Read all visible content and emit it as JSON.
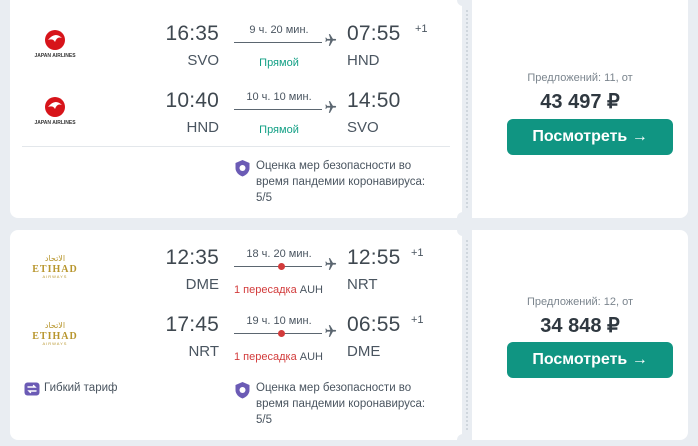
{
  "results": [
    {
      "legs": [
        {
          "airline": "JAPAN AIRLINES",
          "dep_time": "16:35",
          "dep_code": "SVO",
          "duration": "9 ч. 20 мин.",
          "arr_time": "07:55",
          "arr_plus": "+1",
          "arr_code": "HND",
          "route_note": "Прямой"
        },
        {
          "airline": "JAPAN AIRLINES",
          "dep_time": "10:40",
          "dep_code": "HND",
          "duration": "10 ч. 10 мин.",
          "arr_time": "14:50",
          "arr_plus": "",
          "arr_code": "SVO",
          "route_note": "Прямой"
        }
      ],
      "safety": "Оценка мер безопасности во время пандемии коронавируса: 5/5",
      "offers": "Предложений: 11, от",
      "price": "43 497 ₽",
      "button": "Посмотреть →"
    },
    {
      "legs": [
        {
          "airline": "ETIHAD AIRWAYS",
          "airline_ar": "الاتحاد",
          "dep_time": "12:35",
          "dep_code": "DME",
          "duration": "18 ч. 20 мин.",
          "arr_time": "12:55",
          "arr_plus": "+1",
          "arr_code": "NRT",
          "stops_count": "1 пересадка",
          "stops_airport": "AUH"
        },
        {
          "airline": "ETIHAD AIRWAYS",
          "airline_ar": "الاتحاد",
          "dep_time": "17:45",
          "dep_code": "NRT",
          "duration": "19 ч. 10 мин.",
          "arr_time": "06:55",
          "arr_plus": "+1",
          "arr_code": "DME",
          "stops_count": "1 пересадка",
          "stops_airport": "AUH"
        }
      ],
      "flex": "Гибкий тариф",
      "safety": "Оценка мер безопасности во время пандемии коронавируса: 5/5",
      "offers": "Предложений: 12, от",
      "price": "34 848 ₽",
      "button": "Посмотреть →"
    }
  ],
  "colors": {
    "accent": "#109582",
    "direct": "#13a085",
    "stop": "#d23b3b",
    "jal_red": "#d7141a",
    "etihad_gold": "#b8962e",
    "shield_purple": "#6b5bb5"
  },
  "icons": [
    "jal-crane-icon",
    "etihad-logo",
    "plane-icon",
    "shield-icon",
    "flexible-fare-icon",
    "arrow-right-icon"
  ]
}
